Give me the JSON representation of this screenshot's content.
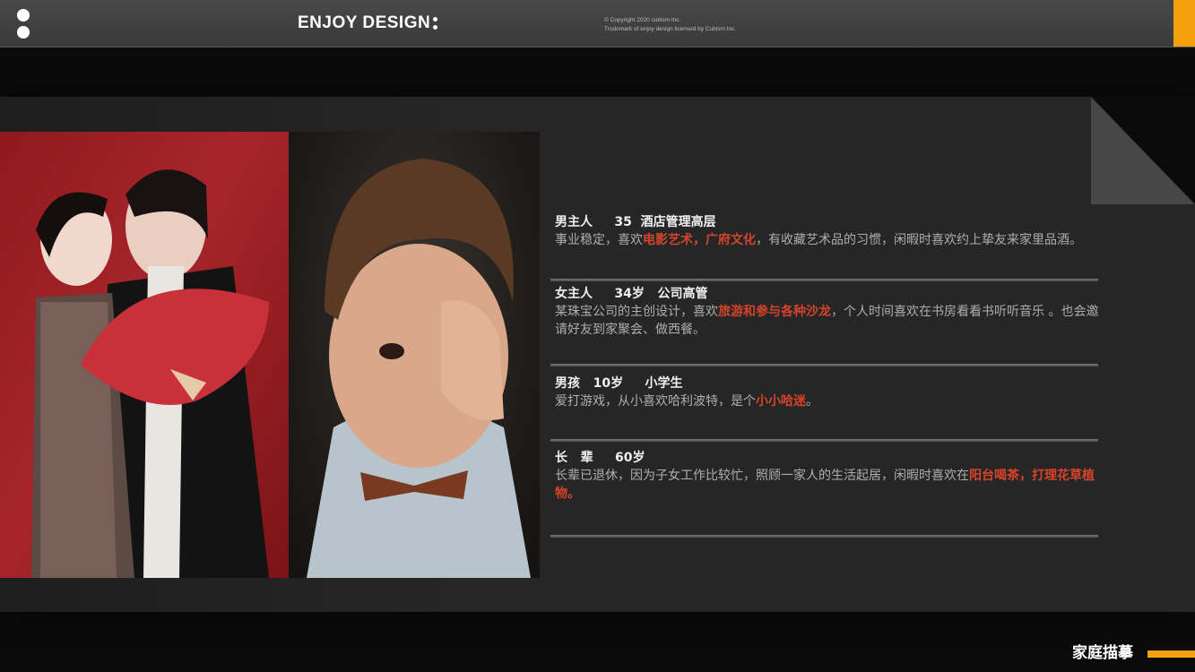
{
  "header": {
    "brand": "ENJOY DESIGN",
    "copyright_line1": "© Copyright 2020 cubism Inc.",
    "copyright_line2": "Trodomark of enjoy design licensed by Cubism Inc."
  },
  "colors": {
    "accent": "#f5a10f",
    "highlight": "#d6432b",
    "background": "#0b0b0b",
    "panel": "#262626"
  },
  "photos": [
    {
      "name": "couple-photo"
    },
    {
      "name": "boy-photo"
    }
  ],
  "members": [
    {
      "head": "男主人     35  酒店管理高层",
      "text_before": "事业稳定，喜欢",
      "highlight": "电影艺术，广府文化",
      "text_after": "，有收藏艺术品的习惯，闲暇时喜欢约上挚友来家里品酒。"
    },
    {
      "head": "女主人     34岁   公司高管",
      "text_before": "某珠宝公司的主创设计，喜欢",
      "highlight": "旅游和参与各种沙龙",
      "text_after": "，个人时间喜欢在书房看看书听听音乐 。也会邀请好友到家聚会、做西餐。"
    },
    {
      "head": "男孩   10岁     小学生",
      "text_before": "爱打游戏，从小喜欢哈利波特，是个",
      "highlight": "小小哈迷",
      "text_after": "。"
    },
    {
      "head": "长   辈     60岁",
      "text_before": "长辈已退休，因为子女工作比较忙，照顾一家人的生活起居，闲暇时喜欢在",
      "highlight": "阳台喝茶，打理花草植物。",
      "text_after": ""
    }
  ],
  "footer": {
    "title": "家庭描摹"
  }
}
